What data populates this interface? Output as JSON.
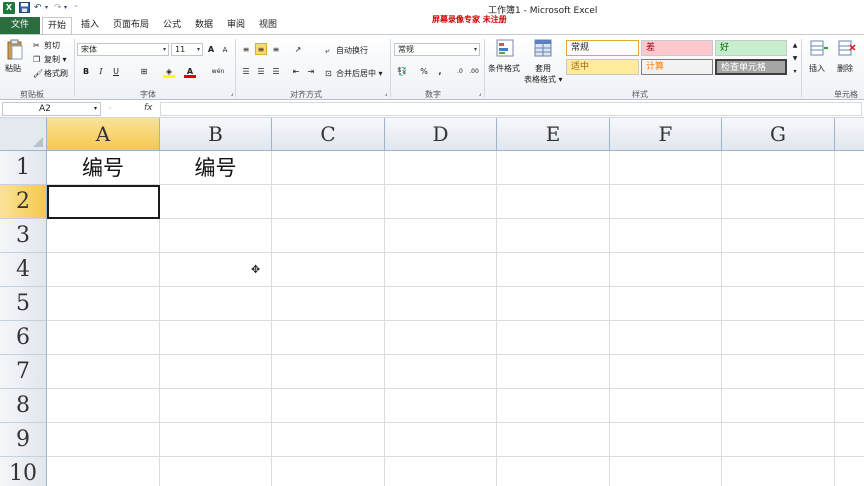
{
  "window": {
    "title": "工作簿1 - Microsoft Excel",
    "recorder_banner": "屏幕录像专家  未注册"
  },
  "quick_access": {
    "app_icon": "excel-logo-icon",
    "save_icon": "save-icon",
    "undo_icon": "undo-icon",
    "redo_icon": "redo-icon",
    "customize_icon": "chevron-down-icon"
  },
  "tabs": [
    {
      "label": "文件",
      "active": false
    },
    {
      "label": "开始",
      "active": true
    },
    {
      "label": "插入",
      "active": false
    },
    {
      "label": "页面布局",
      "active": false
    },
    {
      "label": "公式",
      "active": false
    },
    {
      "label": "数据",
      "active": false
    },
    {
      "label": "审阅",
      "active": false
    },
    {
      "label": "视图",
      "active": false
    }
  ],
  "ribbon": {
    "clipboard": {
      "paste": "粘贴",
      "cut": "剪切",
      "copy": "复制 ▾",
      "format_painter": "格式刷",
      "label": "剪贴板"
    },
    "font": {
      "name": "宋体",
      "size": "11",
      "label": "字体",
      "bold": "B",
      "italic": "I",
      "underline": "U",
      "grow": "A",
      "shrink": "A",
      "pinyin": "wén"
    },
    "alignment": {
      "wrap": "自动换行",
      "merge": "合并后居中 ▾",
      "label": "对齐方式"
    },
    "number": {
      "format": "常规",
      "percent": "%",
      "comma": ",",
      "label": "数字"
    },
    "styles": {
      "conditional": "条件格式",
      "table": "套用",
      "table2": "表格格式 ▾",
      "normal": "常规",
      "bad": "差",
      "good": "好",
      "neutral": "适中",
      "calc": "计算",
      "check": "检查单元格",
      "label": "样式"
    },
    "cells": {
      "insert": "插入",
      "delete": "删除",
      "label": "单元格"
    }
  },
  "colors": {
    "file_tab": "#2a6e3f",
    "selected_header": "#f4c94c",
    "style_bad": "#ffc7ce",
    "style_good": "#c6efce",
    "style_neutral": "#ffeb9c",
    "style_check": "#7f7f7f"
  },
  "formula_bar": {
    "name_box": "A2",
    "fx": "fx",
    "formula": ""
  },
  "grid": {
    "columns": [
      "A",
      "B",
      "C",
      "D",
      "E",
      "F",
      "G"
    ],
    "rows": [
      "1",
      "2",
      "3",
      "4",
      "5",
      "6",
      "7",
      "8",
      "9",
      "10"
    ],
    "selected_column": "A",
    "selected_row": "2",
    "active_cell": "A2",
    "cells": {
      "A1": "编号",
      "B1": "编号"
    }
  }
}
